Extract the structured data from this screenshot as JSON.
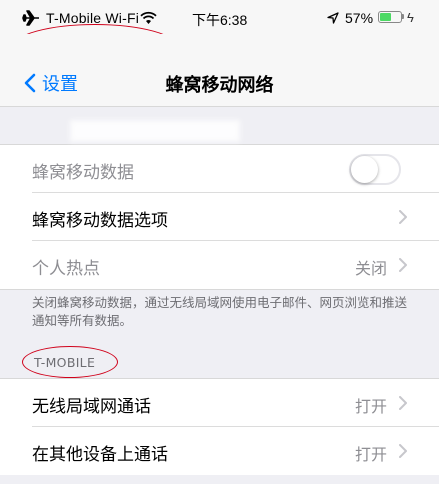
{
  "status_bar": {
    "carrier": "T-Mobile Wi-Fi",
    "time": "下午6:38",
    "battery_percent_label": "57%",
    "battery_level": 0.57,
    "icons": [
      "airplane-icon",
      "wifi-icon",
      "location-icon",
      "battery-icon",
      "charging-bolt-icon"
    ],
    "battery_color": "#4cd964"
  },
  "nav": {
    "back_label": "设置",
    "title": "蜂窝移动网络",
    "accent_color": "#007aff"
  },
  "cellular_group": {
    "rows": [
      {
        "label": "蜂窝移动数据",
        "control": "toggle",
        "toggle_on": false
      },
      {
        "label": "蜂窝移动数据选项"
      },
      {
        "label": "个人热点",
        "value": "关闭"
      }
    ]
  },
  "footnote": "关闭蜂窝移动数据，通过无线局域网使用电子邮件、网页浏览和推送通知等所有数据。",
  "tmobile_section": {
    "header": "T-MOBILE",
    "rows": [
      {
        "label": "无线局域网通话",
        "value": "打开"
      },
      {
        "label": "在其他设备上通话",
        "value": "打开"
      }
    ]
  },
  "annotation_color": "#d0021b"
}
